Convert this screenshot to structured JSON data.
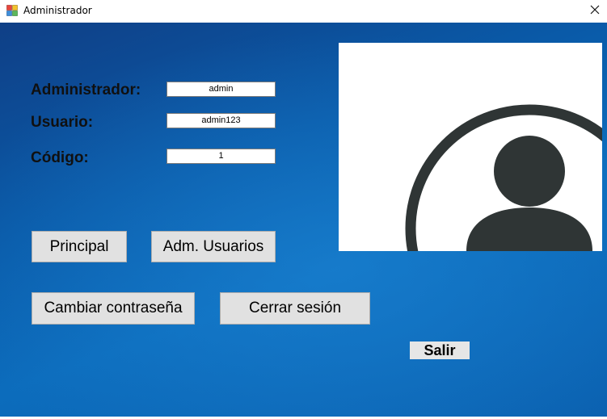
{
  "window": {
    "title": "Administrador",
    "close_glyph": "✕",
    "app_icon": "windows-form-icon"
  },
  "fields": {
    "administrador": {
      "label": "Administrador:",
      "value": "admin"
    },
    "usuario": {
      "label": "Usuario:",
      "value": "admin123"
    },
    "codigo": {
      "label": "Código:",
      "value": "1"
    }
  },
  "buttons": {
    "principal": "Principal",
    "adm_usuarios": "Adm. Usuarios",
    "cambiar_contrasena": "Cambiar contraseña",
    "cerrar_sesion": "Cerrar sesión",
    "salir": "Salir"
  },
  "avatar": {
    "icon": "user-avatar-icon",
    "color": "#2f3535"
  },
  "colors": {
    "background_dark": "#0f3f86",
    "background_light": "#0c6cbc",
    "button_face": "#e1e1e1"
  }
}
